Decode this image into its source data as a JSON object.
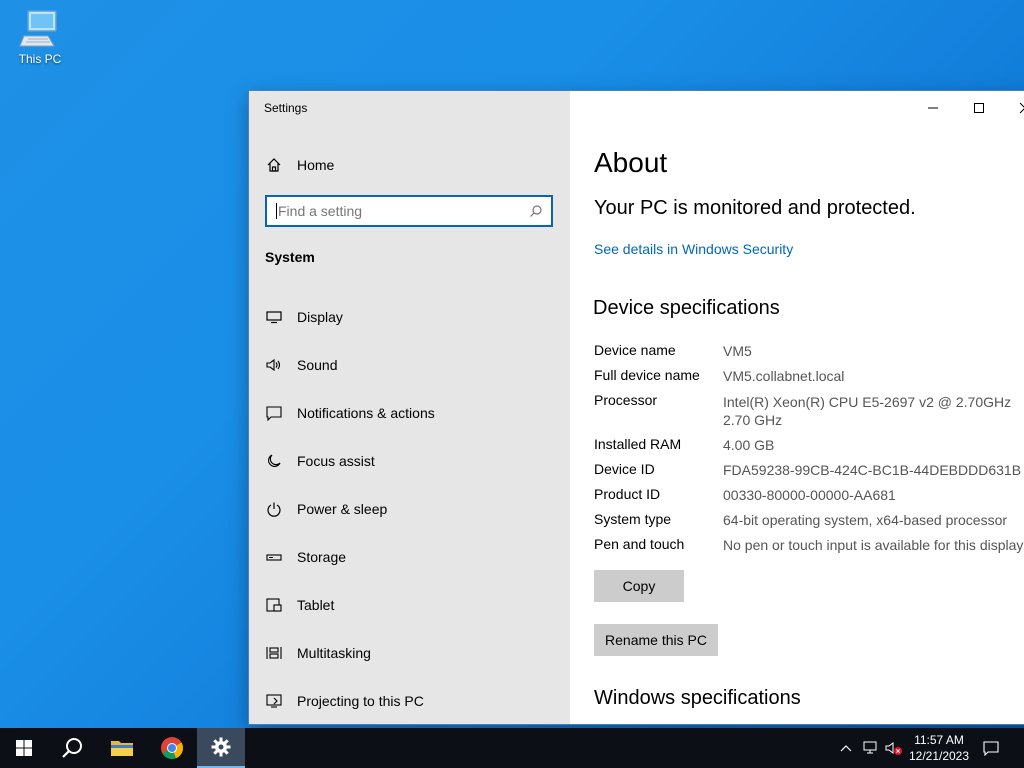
{
  "desktop": {
    "this_pc_label": "This PC"
  },
  "window": {
    "title": "Settings",
    "sidebar": {
      "home_label": "Home",
      "search_placeholder": "Find a setting",
      "section": "System",
      "items": [
        {
          "label": "Display",
          "icon": "display-icon"
        },
        {
          "label": "Sound",
          "icon": "sound-icon"
        },
        {
          "label": "Notifications & actions",
          "icon": "notifications-icon"
        },
        {
          "label": "Focus assist",
          "icon": "moon-icon"
        },
        {
          "label": "Power & sleep",
          "icon": "power-icon"
        },
        {
          "label": "Storage",
          "icon": "storage-icon"
        },
        {
          "label": "Tablet",
          "icon": "tablet-icon"
        },
        {
          "label": "Multitasking",
          "icon": "multitasking-icon"
        },
        {
          "label": "Projecting to this PC",
          "icon": "projecting-icon"
        }
      ]
    },
    "content": {
      "title": "About",
      "status": "Your PC is monitored and protected.",
      "security_link": "See details in Windows Security",
      "device_specs_heading": "Device specifications",
      "specs": [
        {
          "label": "Device name",
          "value": "VM5"
        },
        {
          "label": "Full device name",
          "value": "VM5.collabnet.local"
        },
        {
          "label": "Processor",
          "value": "Intel(R) Xeon(R) CPU E5-2697 v2 @ 2.70GHz",
          "value2": "2.70 GHz"
        },
        {
          "label": "Installed RAM",
          "value": "4.00 GB"
        },
        {
          "label": "Device ID",
          "value": "FDA59238-99CB-424C-BC1B-44DEBDDD631B"
        },
        {
          "label": "Product ID",
          "value": "00330-80000-00000-AA681"
        },
        {
          "label": "System type",
          "value": "64-bit operating system, x64-based processor"
        },
        {
          "label": "Pen and touch",
          "value": "No pen or touch input is available for this display"
        }
      ],
      "copy_button": "Copy",
      "rename_button": "Rename this PC",
      "windows_specs_heading": "Windows specifications"
    }
  },
  "taskbar": {
    "time": "11:57 AM",
    "date": "12/21/2023",
    "accent": "#76b9ed"
  }
}
